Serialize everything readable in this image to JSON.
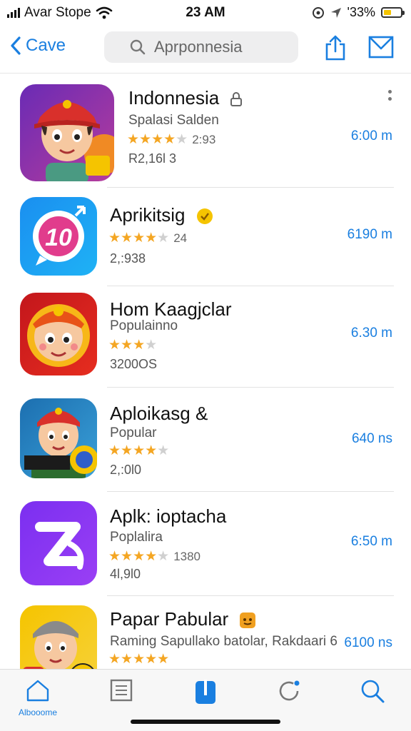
{
  "status_bar": {
    "carrier": "Avar Stope",
    "time": "23 AM",
    "battery": "'33%"
  },
  "nav": {
    "back_label": "Cave",
    "search_text": "Aprponnesia"
  },
  "apps": [
    {
      "name": "Indonnesia",
      "category": "Spalasi Salden",
      "rating_count": "2:93",
      "extra": "R2,16l 3",
      "size": "6:00 m",
      "rating": 4.5
    },
    {
      "name": "Aprikitsig",
      "category": "",
      "rating_count": "24",
      "extra": "2,:938",
      "size": "6190 m",
      "rating": 4
    },
    {
      "name": "Hom Kaagjclar",
      "category": "Populainno",
      "rating_count": "",
      "extra": "3200OS",
      "size": "6.30 m",
      "rating": 3.5
    },
    {
      "name": "Aploikasg &",
      "category": "Popular",
      "rating_count": "",
      "extra": "2,:0l0",
      "size": "640 ns",
      "rating": 4.5
    },
    {
      "name": "Aplk: ioptacha",
      "category": "Poplalira",
      "rating_count": "1380",
      "extra": "4l,9l0",
      "size": "6:50 m",
      "rating": 4.5
    },
    {
      "name": "Papar Pabular",
      "category": "Raming Sapullako batolar, Rakdaari 6,",
      "rating_count": "",
      "extra": "",
      "size": "6100 ns",
      "rating": 5
    }
  ],
  "tabbar": {
    "first_label": "Albooome"
  },
  "colors": {
    "accent": "#1a7fe0",
    "star": "#f4a623"
  }
}
